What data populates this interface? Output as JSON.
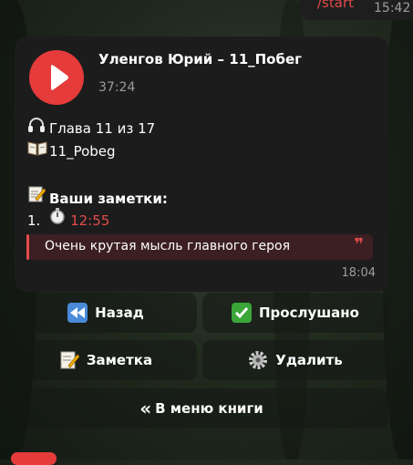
{
  "top_message": {
    "command": "/start",
    "time": "15:42"
  },
  "audio": {
    "title": "Уленгов Юрий – 11_Побег",
    "duration": "37:24"
  },
  "info": {
    "chapter": "Глава 11 из 17",
    "file": "11_Pobeg"
  },
  "notes": {
    "heading": "Ваши заметки:",
    "number": "1.",
    "timestamp": "12:55",
    "quote": "Очень крутая мысль главного героя",
    "quote_mark": "❞"
  },
  "message_time": "18:04",
  "keyboard": {
    "back": "Назад",
    "listened": "Прослушано",
    "note": "Заметка",
    "delete": "Удалить",
    "book_menu": "В меню книги",
    "book_menu_icon": "«"
  },
  "icons": {
    "play": "play-icon",
    "headphones": "headphones-icon",
    "book": "open-book-icon",
    "memo": "memo-icon",
    "stopwatch": "stopwatch-icon",
    "rewind": "rewind-icon",
    "check": "check-mark-icon",
    "gear": "gear-icon"
  },
  "colors": {
    "accent": "#e53b3b",
    "bubble": "#1c1c1d",
    "check_green": "#3aa63a",
    "rewind_blue": "#4a8ad8"
  }
}
